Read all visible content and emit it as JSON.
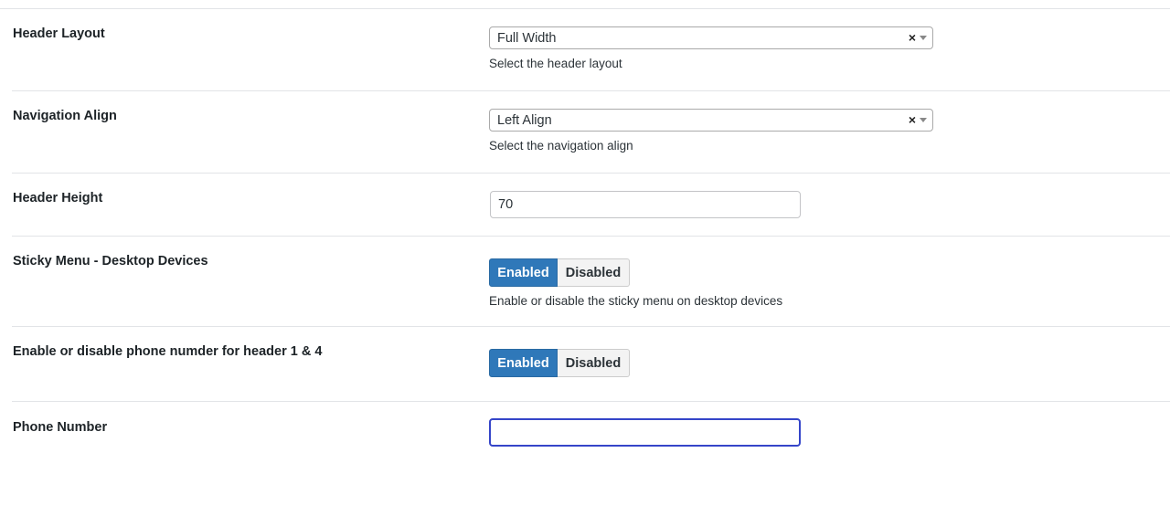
{
  "settings": {
    "header_layout": {
      "label": "Header Layout",
      "value": "Full Width",
      "clear": "×",
      "description": "Select the header layout"
    },
    "navigation_align": {
      "label": "Navigation Align",
      "value": "Left Align",
      "clear": "×",
      "description": "Select the navigation align"
    },
    "header_height": {
      "label": "Header Height",
      "value": "70"
    },
    "sticky_menu": {
      "label": "Sticky Menu - Desktop Devices",
      "enabled_label": "Enabled",
      "disabled_label": "Disabled",
      "selected": "Enabled",
      "description": "Enable or disable the sticky menu on desktop devices"
    },
    "phone_toggle": {
      "label": "Enable or disable phone numder for header 1 & 4",
      "enabled_label": "Enabled",
      "disabled_label": "Disabled",
      "selected": "Enabled"
    },
    "phone_number": {
      "label": "Phone Number",
      "value": ""
    }
  },
  "colors": {
    "toggle_active": "#2f78b9",
    "focus_border": "#3545c9",
    "row_divider": "#e2e4e7"
  }
}
